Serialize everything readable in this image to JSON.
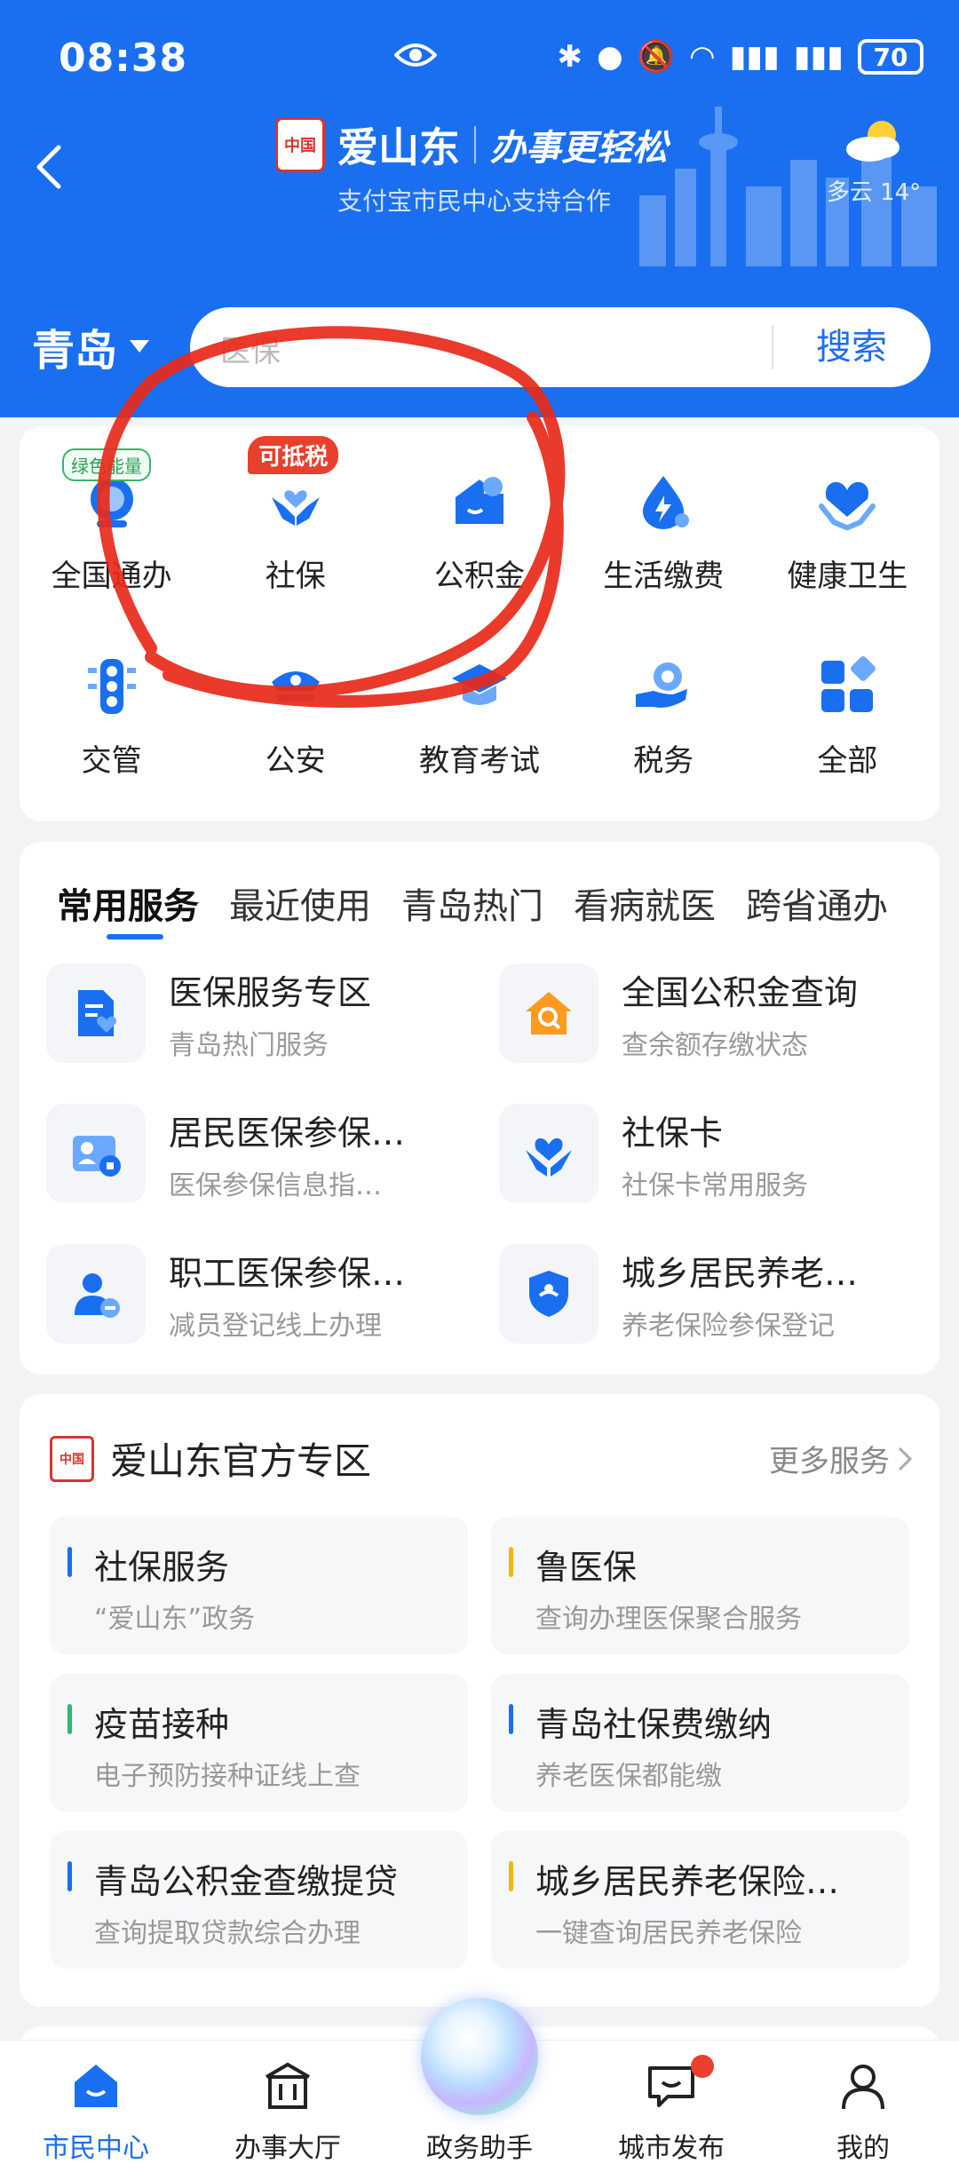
{
  "status_bar": {
    "time": "08:38",
    "battery": "70"
  },
  "header": {
    "brand_name": "爱山东",
    "slogan": "办事更轻松",
    "subtitle": "支付宝市民中心支持合作",
    "weather": "多云 14°",
    "seal_text": "中国"
  },
  "search": {
    "city": "青岛",
    "placeholder": "医保",
    "button": "搜索"
  },
  "grid": [
    {
      "label": "全国通办",
      "icon": "globe-icon",
      "badge": "绿色能量"
    },
    {
      "label": "社保",
      "icon": "social-security-icon",
      "badge": "可抵税"
    },
    {
      "label": "公积金",
      "icon": "housing-fund-icon"
    },
    {
      "label": "生活缴费",
      "icon": "utility-payment-icon"
    },
    {
      "label": "健康卫生",
      "icon": "health-icon"
    },
    {
      "label": "交管",
      "icon": "traffic-light-icon"
    },
    {
      "label": "公安",
      "icon": "police-icon"
    },
    {
      "label": "教育考试",
      "icon": "graduation-cap-icon"
    },
    {
      "label": "税务",
      "icon": "tax-icon"
    },
    {
      "label": "全部",
      "icon": "all-apps-icon"
    }
  ],
  "tabs": [
    "常用服务",
    "最近使用",
    "青岛热门",
    "看病就医",
    "跨省通办"
  ],
  "services": [
    {
      "title": "医保服务专区",
      "sub": "青岛热门服务",
      "icon": "medical-doc-icon"
    },
    {
      "title": "全国公积金查询",
      "sub": "查余额存缴状态",
      "icon": "house-search-icon"
    },
    {
      "title": "居民医保参保…",
      "sub": "医保参保信息指…",
      "icon": "resident-card-icon"
    },
    {
      "title": "社保卡",
      "sub": "社保卡常用服务",
      "icon": "hands-heart-icon"
    },
    {
      "title": "职工医保参保…",
      "sub": "减员登记线上办理",
      "icon": "user-minus-icon"
    },
    {
      "title": "城乡居民养老…",
      "sub": "养老保险参保登记",
      "icon": "shield-icon"
    }
  ],
  "official": {
    "title": "爱山东官方专区",
    "more": "更多服务",
    "items": [
      {
        "name": "社保服务",
        "desc": "“爱山东”政务",
        "color": "#1a6ff0"
      },
      {
        "name": "鲁医保",
        "desc": "查询办理医保聚合服务",
        "color": "#f5b400"
      },
      {
        "name": "疫苗接种",
        "desc": "电子预防接种证线上查",
        "color": "#2eb872"
      },
      {
        "name": "青岛社保费缴纳",
        "desc": "养老医保都能缴",
        "color": "#1a6ff0"
      },
      {
        "name": "青岛公积金查缴提贷",
        "desc": "查询提取贷款综合办理",
        "color": "#1a6ff0"
      },
      {
        "name": "城乡居民养老保险…",
        "desc": "一键查询居民养老保险",
        "color": "#f5b400"
      }
    ]
  },
  "bottom_nav": [
    "市民中心",
    "办事大厅",
    "政务助手",
    "城市发布",
    "我的"
  ]
}
